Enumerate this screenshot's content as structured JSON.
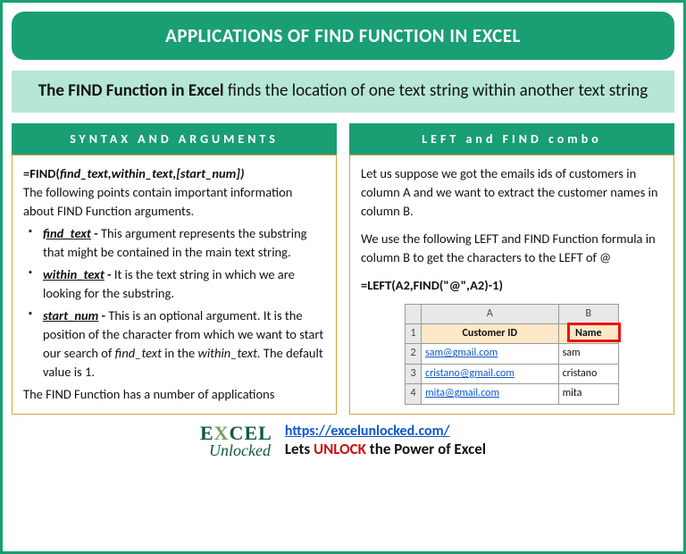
{
  "title": "APPLICATIONS OF FIND FUNCTION IN EXCEL",
  "subtitle_bold": "The FIND Function in Excel",
  "subtitle_rest": " finds the location of one text string within another text string",
  "left": {
    "header": "SYNTAX AND ARGUMENTS",
    "formula_pre": "=FIND(",
    "formula_args": "find_text,within_text,[start_num])",
    "intro": "The following points contain important information about FIND Function arguments.",
    "b1_name": "find_text",
    "b1_dash": " - ",
    "b1_desc": "This argument represents the substring that might be contained in the main text string.",
    "b2_name": "within_text",
    "b2_dash": " - ",
    "b2_desc": "It is the text string in which we are looking for the substring.",
    "b3_name": "start_num",
    "b3_dash": " - ",
    "b3_desc_a": "This is an optional argument. It is the position of the character from which we want to start our search of ",
    "b3_desc_b": "find_text",
    "b3_desc_c": " in the ",
    "b3_desc_d": "within_text.",
    "b3_desc_e": " The default value is 1.",
    "outro": "The FIND Function has a number of applications"
  },
  "right": {
    "header": "LEFT and FIND combo",
    "p1": "Let us suppose we got the emails ids of customers in column A and we want to extract the customer names in column B.",
    "p2": "We use the following LEFT and FIND Function formula in column B to get the characters to the LEFT of @",
    "formula": "=LEFT(A2,FIND(\"@\",A2)-1)",
    "table": {
      "colA": "A",
      "colB": "B",
      "h1": "Customer ID",
      "h2": "Name",
      "r2a": "sam@gmail.com",
      "r2b": "sam",
      "r3a": "cristano@gmail.com",
      "r3b": "cristano",
      "r4a": "mita@gmail.com",
      "r4b": "mita",
      "row1": "1",
      "row2": "2",
      "row3": "3",
      "row4": "4"
    }
  },
  "footer": {
    "logo_top_pre": "E",
    "logo_top_x": "X",
    "logo_top_post": "CEL",
    "logo_bot": "Unlocked",
    "url": "https://excelunlocked.com/",
    "tag_a": "Lets ",
    "tag_b": "UNLOCK",
    "tag_c": " the Power of Excel"
  }
}
